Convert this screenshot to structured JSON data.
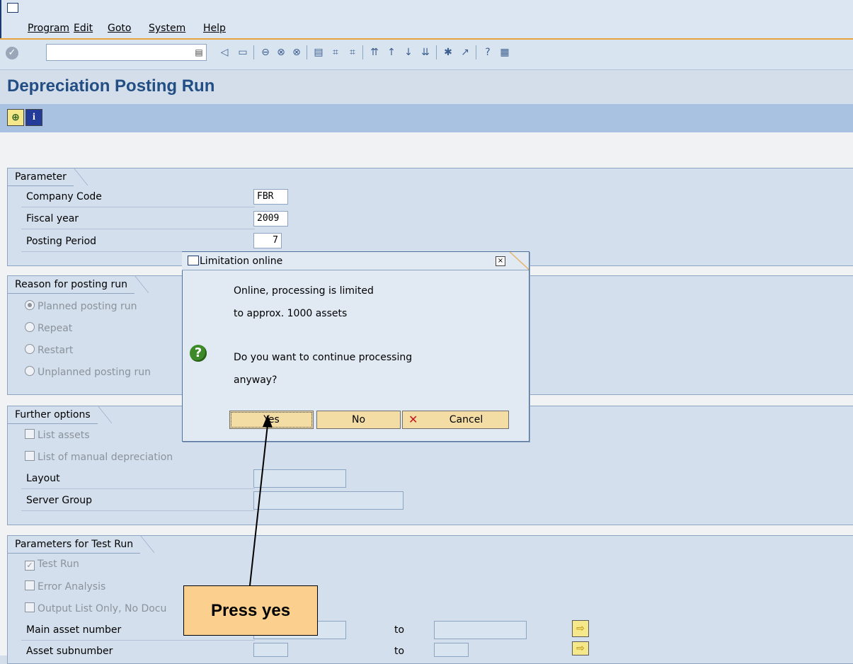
{
  "menu": {
    "items": [
      "Program",
      "Edit",
      "Goto",
      "System",
      "Help"
    ]
  },
  "toolbar": {
    "command_value": "",
    "icons": [
      "enter-icon",
      "save-icon",
      "back-icon",
      "exit-icon",
      "cancel-icon",
      "print-icon",
      "find-icon",
      "find-next-icon",
      "first-page-icon",
      "prev-page-icon",
      "next-page-icon",
      "last-page-icon",
      "new-session-icon",
      "shortcut-icon",
      "help-icon",
      "layout-icon"
    ]
  },
  "page": {
    "title": "Depreciation Posting Run"
  },
  "app_toolbar": {
    "execute_icon": "execute-icon",
    "info_icon": "info-icon",
    "info_glyph": "i"
  },
  "parameter": {
    "title": "Parameter",
    "company_code_label": "Company Code",
    "company_code_value": "FBR",
    "fiscal_year_label": "Fiscal year",
    "fiscal_year_value": "2009",
    "posting_period_label": "Posting Period",
    "posting_period_value": "7"
  },
  "reason": {
    "title": "Reason for posting run",
    "options": [
      "Planned posting run",
      "Repeat",
      "Restart",
      "Unplanned posting run"
    ],
    "selected": "Planned posting run"
  },
  "further": {
    "title": "Further options",
    "list_assets": "List assets",
    "list_manual": "List of manual depreciation",
    "layout_label": "Layout",
    "server_group_label": "Server Group"
  },
  "test_run": {
    "title": "Parameters for Test Run",
    "test_run": "Test Run",
    "test_run_checked": true,
    "error_analysis": "Error Analysis",
    "output_list": "Output List Only, No Docu",
    "main_asset_label": "Main asset number",
    "asset_sub_label": "Asset subnumber",
    "to_label": "to"
  },
  "dialog": {
    "title": "Limitation online",
    "line1": "Online, processing is limited",
    "line2": "to approx. 1000  assets",
    "line3": "Do you want to continue processing",
    "line4": "anyway?",
    "yes": "Yes",
    "no": "No",
    "cancel": "Cancel"
  },
  "callout": {
    "text": "Press yes"
  }
}
